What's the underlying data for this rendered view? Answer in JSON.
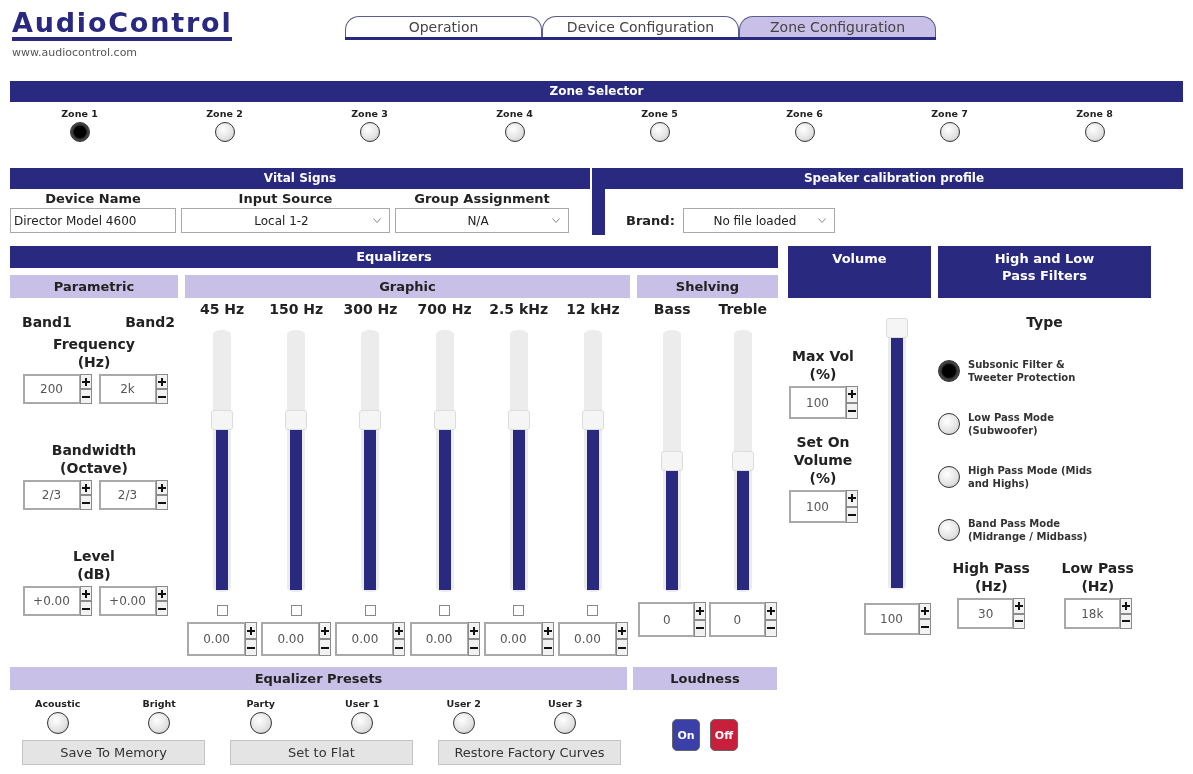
{
  "header": {
    "logo": "AudioControl",
    "url": "www.audiocontrol.com"
  },
  "tabs": [
    {
      "label": "Operation",
      "selected": false
    },
    {
      "label": "Device Configuration",
      "selected": false
    },
    {
      "label": "Zone Configuration",
      "selected": true
    }
  ],
  "zone_selector": {
    "title": "Zone Selector",
    "zones": [
      {
        "label": "Zone 1",
        "selected": true
      },
      {
        "label": "Zone 2",
        "selected": false
      },
      {
        "label": "Zone 3",
        "selected": false
      },
      {
        "label": "Zone 4",
        "selected": false
      },
      {
        "label": "Zone 5",
        "selected": false
      },
      {
        "label": "Zone 6",
        "selected": false
      },
      {
        "label": "Zone 7",
        "selected": false
      },
      {
        "label": "Zone 8",
        "selected": false
      }
    ]
  },
  "vital_signs": {
    "title": "Vital Signs",
    "fields": [
      {
        "label": "Device Name",
        "kind": "text",
        "value": "Director Model 4600"
      },
      {
        "label": "Input Source",
        "kind": "select",
        "value": "Local 1-2"
      },
      {
        "label": "Group Assignment",
        "kind": "select",
        "value": "N/A"
      }
    ]
  },
  "speaker_calibration": {
    "title": "Speaker calibration profile",
    "brand": {
      "label": "Brand:",
      "value": "No file loaded"
    }
  },
  "equalizers": {
    "title": "Equalizers",
    "parametric": {
      "title": "Parametric",
      "bands": [
        "Band1",
        "Band2"
      ],
      "settings": [
        {
          "label": "Frequency\n(Hz)",
          "values": [
            "200",
            "2k"
          ]
        },
        {
          "label": "Bandwidth\n(Octave)",
          "values": [
            "2/3",
            "2/3"
          ]
        },
        {
          "label": "Level\n(dB)",
          "values": [
            "+0.00",
            "+0.00"
          ]
        }
      ]
    },
    "graphic": {
      "title": "Graphic",
      "bands": [
        {
          "label": "45 Hz",
          "level": 0.67,
          "checked": false,
          "value": "0.00"
        },
        {
          "label": "150 Hz",
          "level": 0.67,
          "checked": false,
          "value": "0.00"
        },
        {
          "label": "300 Hz",
          "level": 0.67,
          "checked": false,
          "value": "0.00"
        },
        {
          "label": "700 Hz",
          "level": 0.67,
          "checked": false,
          "value": "0.00"
        },
        {
          "label": "2.5 kHz",
          "level": 0.67,
          "checked": false,
          "value": "0.00"
        },
        {
          "label": "12 kHz",
          "level": 0.67,
          "checked": false,
          "value": "0.00"
        }
      ]
    },
    "shelving": {
      "title": "Shelving",
      "bands": [
        {
          "label": "Bass",
          "level": 0.5,
          "value": "0"
        },
        {
          "label": "Treble",
          "level": 0.5,
          "value": "0"
        }
      ]
    }
  },
  "volume": {
    "title": "Volume",
    "settings": [
      {
        "label": "Max Vol\n(%)",
        "value": "100"
      },
      {
        "label": "Set On\nVolume\n(%)",
        "value": "100"
      }
    ],
    "level": 1,
    "value": "100"
  },
  "filters": {
    "title": "High and Low\nPass Filters",
    "type_label": "Type",
    "types": [
      {
        "label": "Subsonic Filter & Tweeter Protection",
        "selected": true
      },
      {
        "label": "Low Pass Mode (Subwoofer)",
        "selected": false
      },
      {
        "label": "High Pass Mode (Mids and Highs)",
        "selected": false
      },
      {
        "label": "Band Pass Mode (Midrange / Midbass)",
        "selected": false
      }
    ],
    "cutoffs": [
      {
        "label": "High Pass\n(Hz)",
        "value": "30"
      },
      {
        "label": "Low Pass\n(Hz)",
        "value": "18k"
      }
    ]
  },
  "presets": {
    "title": "Equalizer Presets",
    "items": [
      {
        "label": "Acoustic",
        "selected": false
      },
      {
        "label": "Bright",
        "selected": false
      },
      {
        "label": "Party",
        "selected": false
      },
      {
        "label": "User 1",
        "selected": false
      },
      {
        "label": "User 2",
        "selected": false
      },
      {
        "label": "User 3",
        "selected": false
      }
    ],
    "buttons": [
      "Save To Memory",
      "Set to Flat",
      "Restore Factory Curves"
    ]
  },
  "loudness": {
    "title": "Loudness",
    "buttons": [
      {
        "label": "On",
        "color": "#3b3fa8"
      },
      {
        "label": "Off",
        "color": "#c8203c"
      }
    ]
  }
}
